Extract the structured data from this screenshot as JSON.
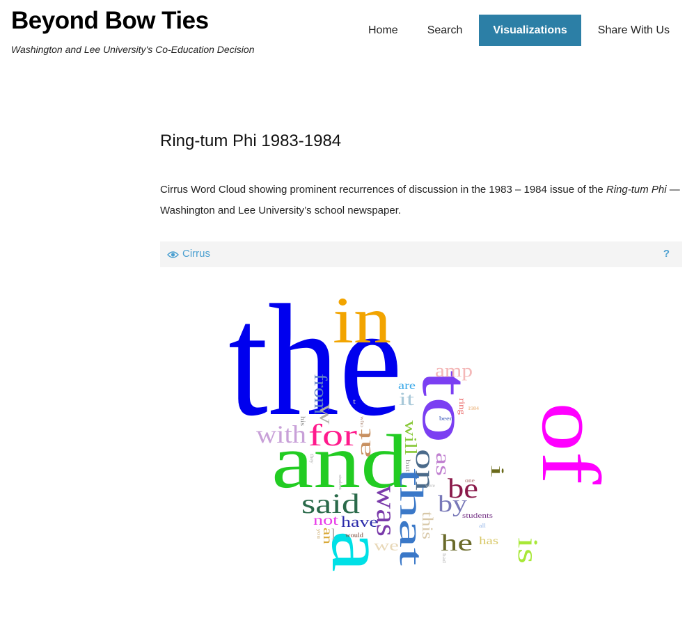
{
  "header": {
    "site_title": "Beyond Bow Ties",
    "tagline": "Washington and Lee University's Co-Education Decision"
  },
  "nav": {
    "items": [
      {
        "label": "Home",
        "active": false
      },
      {
        "label": "Search",
        "active": false
      },
      {
        "label": "Visualizations",
        "active": true
      },
      {
        "label": "Share With Us",
        "active": false
      }
    ]
  },
  "main": {
    "heading": "Ring-tum Phi 1983-1984",
    "description": {
      "part1": "Cirrus Word Cloud showing prominent recurrences of discussion in the 1983 – 1984 issue of the ",
      "italic": "Ring-tum Phi",
      "part2": " — Washington and Lee University’s school newspaper."
    }
  },
  "tool": {
    "name": "Cirrus",
    "help": "?",
    "icon": "eye-icon"
  },
  "colors": {
    "accent": "#2c7fa6",
    "link": "#4a9fd0",
    "toolbar_bg": "#f4f4f4"
  },
  "word_cloud": {
    "words": [
      {
        "text": "the",
        "color": "#0000ee"
      },
      {
        "text": "in",
        "color": "#f2a400"
      },
      {
        "text": "to",
        "color": "#7b3ff2"
      },
      {
        "text": "of",
        "color": "#ff00ff"
      },
      {
        "text": "and",
        "color": "#22cc22"
      },
      {
        "text": "a",
        "color": "#00e0e6"
      },
      {
        "text": "for",
        "color": "#ff1a8c"
      },
      {
        "text": "with",
        "color": "#c8a0d8"
      },
      {
        "text": "from",
        "color": "#6080c8"
      },
      {
        "text": "w",
        "color": "#b0b0a8"
      },
      {
        "text": "at",
        "color": "#c89060"
      },
      {
        "text": "amp",
        "color": "#f4b8b8"
      },
      {
        "text": "are",
        "color": "#3aa8e8"
      },
      {
        "text": "it",
        "color": "#a8c8d8"
      },
      {
        "text": "ring",
        "color": "#e86060"
      },
      {
        "text": "1984",
        "color": "#e8a868"
      },
      {
        "text": "been",
        "color": "#3a58b8"
      },
      {
        "text": "will",
        "color": "#88c838"
      },
      {
        "text": "on",
        "color": "#4a6a8a"
      },
      {
        "text": "as",
        "color": "#c080d0"
      },
      {
        "text": "be",
        "color": "#8a1a4a"
      },
      {
        "text": "i",
        "color": "#6a6a1a"
      },
      {
        "text": "said",
        "color": "#2a6a4a"
      },
      {
        "text": "was",
        "color": "#7a3aaa"
      },
      {
        "text": "that",
        "color": "#3a78c8"
      },
      {
        "text": "this",
        "color": "#d8c8a8"
      },
      {
        "text": "by",
        "color": "#7878b8"
      },
      {
        "text": "not",
        "color": "#e83ae8"
      },
      {
        "text": "have",
        "color": "#2a2aaa"
      },
      {
        "text": "an",
        "color": "#d8a838"
      },
      {
        "text": "we",
        "color": "#e8d8b8"
      },
      {
        "text": "he",
        "color": "#6a6a2a"
      },
      {
        "text": "has",
        "color": "#d8c868"
      },
      {
        "text": "is",
        "color": "#a8e838"
      },
      {
        "text": "students",
        "color": "#7a3a8a"
      },
      {
        "text": "all",
        "color": "#98b8e8"
      },
      {
        "text": "would",
        "color": "#7a4a3a"
      },
      {
        "text": "you",
        "color": "#c8a868"
      },
      {
        "text": "his",
        "color": "#8a8a8a"
      },
      {
        "text": "who",
        "color": "#b89888"
      },
      {
        "text": "but",
        "color": "#888888"
      },
      {
        "text": "one",
        "color": "#a86868"
      },
      {
        "text": "they",
        "color": "#a8a8a8"
      },
      {
        "text": "student",
        "color": "#a8a8a8"
      },
      {
        "text": "were",
        "color": "#b8b8b8"
      },
      {
        "text": "had",
        "color": "#b8b8b8"
      },
      {
        "text": "l",
        "color": "#aaaaaa"
      },
      {
        "text": "t",
        "color": "#c8c8c8"
      }
    ]
  }
}
